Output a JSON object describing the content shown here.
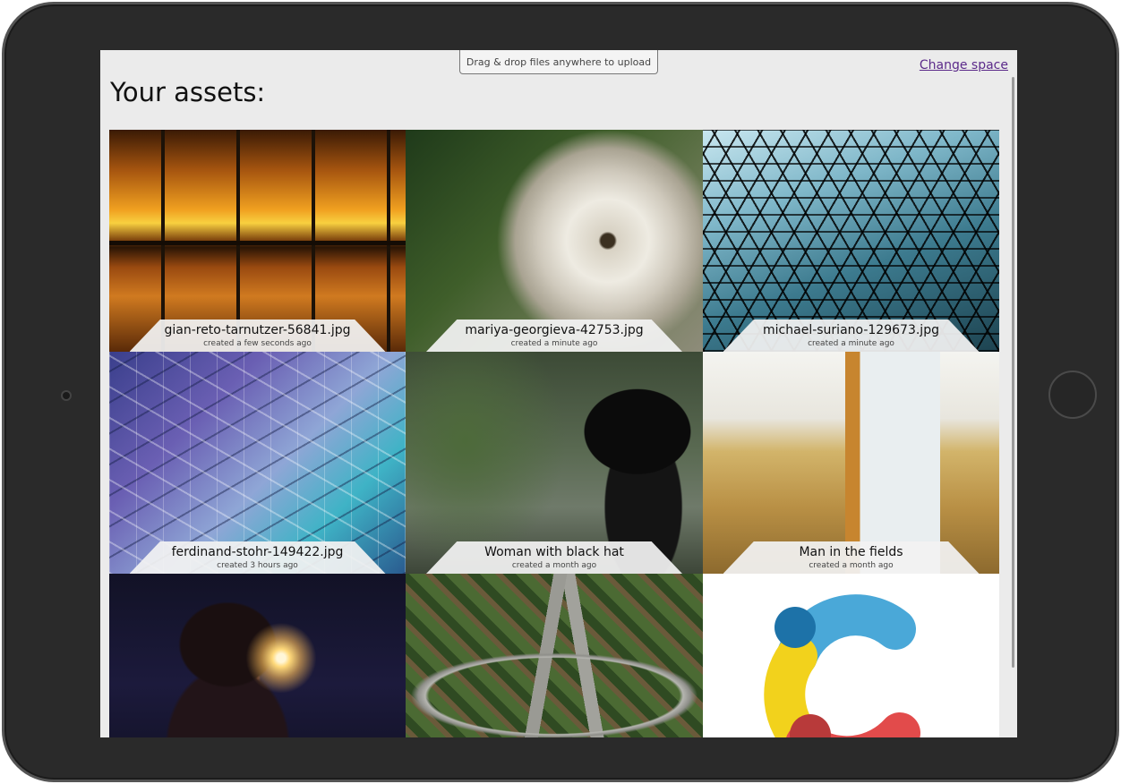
{
  "header": {
    "drop_banner": "Drag & drop files anywhere to upload",
    "change_space": "Change space",
    "title": "Your assets:"
  },
  "assets": [
    {
      "title": "gian-reto-tarnutzer-56841.jpg",
      "created": "created a few seconds ago",
      "art": "greenhouse"
    },
    {
      "title": "mariya-georgieva-42753.jpg",
      "created": "created a minute ago",
      "art": "dandelion"
    },
    {
      "title": "michael-suriano-129673.jpg",
      "created": "created a minute ago",
      "art": "honeycomb"
    },
    {
      "title": "ferdinand-stohr-149422.jpg",
      "created": "created 3 hours ago",
      "art": "facets"
    },
    {
      "title": "Woman with black hat",
      "created": "created a month ago",
      "art": "hat-woman"
    },
    {
      "title": "Man in the fields",
      "created": "created a month ago",
      "art": "fields"
    },
    {
      "art": "sparkler"
    },
    {
      "art": "highway"
    },
    {
      "art": "contentful-logo"
    }
  ],
  "colors": {
    "link": "#5b2a8a",
    "screen_bg": "#ebebeb",
    "bezel": "#2a2a2a",
    "logo_blue": "#4aa8d8",
    "logo_yellow": "#f2d21c",
    "logo_red": "#e24b4b",
    "logo_dark_blue": "#1d72a8"
  },
  "icons": {
    "camera": "camera-icon",
    "home": "home-button-icon",
    "logo": "contentful-logo-icon"
  }
}
